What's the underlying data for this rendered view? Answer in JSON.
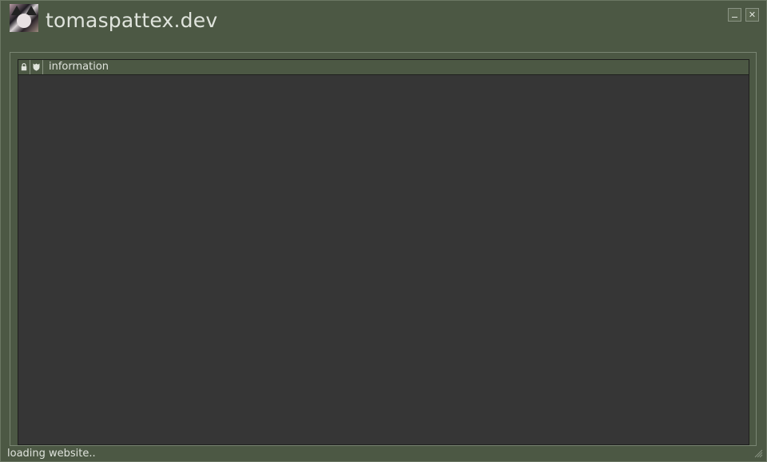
{
  "window": {
    "title": "tomaspattex.dev",
    "avatar_icon": "cat-avatar-icon",
    "minimize_icon": "minimize-icon",
    "close_icon": "close-icon",
    "close_glyph": "✕"
  },
  "list": {
    "columns": [
      {
        "icon": "lock-icon",
        "label": ""
      },
      {
        "icon": "shield-icon",
        "label": ""
      },
      {
        "icon": "",
        "label": "information"
      }
    ],
    "rows": []
  },
  "status": {
    "text": "loading website..",
    "grip_icon": "resize-grip-icon"
  },
  "colors": {
    "window_bg": "#4c5844",
    "list_bg": "#363636",
    "text": "#dfe3dc"
  }
}
